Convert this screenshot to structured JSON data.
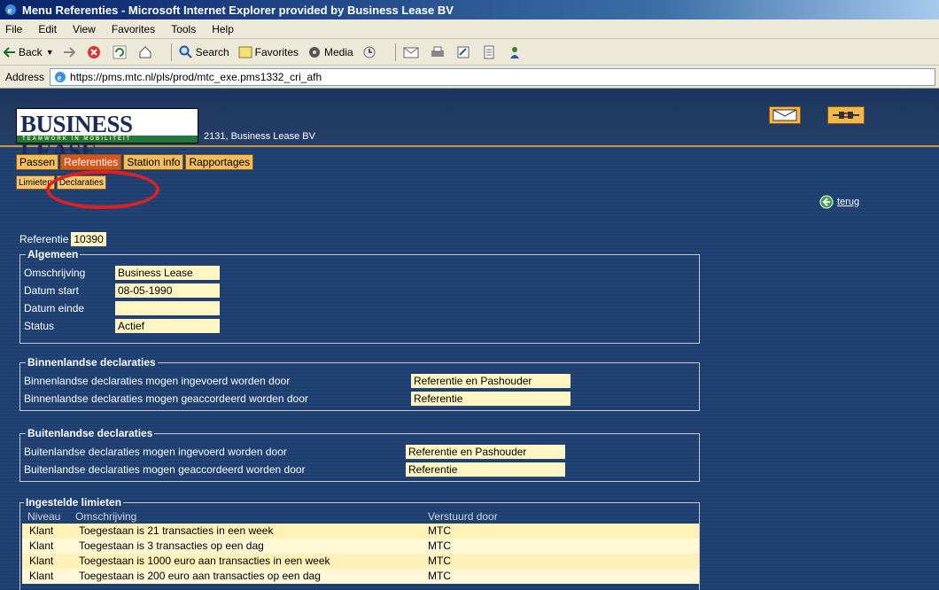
{
  "window": {
    "title": "Menu Referenties - Microsoft Internet Explorer provided by Business Lease BV"
  },
  "menu": [
    "File",
    "Edit",
    "View",
    "Favorites",
    "Tools",
    "Help"
  ],
  "toolbar": {
    "back": "Back",
    "search": "Search",
    "favorites": "Favorites",
    "media": "Media"
  },
  "address": {
    "label": "Address",
    "url": "https://pms.mtc.nl/pls/prod/mtc_exe.pms1332_cri_afh"
  },
  "header": {
    "logo_text": "BUSINESS LEASE",
    "logo_tagline": "TEAMWORK IN MOBILITEIT",
    "company": "2131, Business Lease BV"
  },
  "tabs": [
    "Passen",
    "Referenties",
    "Station info",
    "Rapportages"
  ],
  "subtabs": [
    "Limieten",
    "Declaraties"
  ],
  "back_link": "terug",
  "referentie": {
    "label": "Referentie",
    "value": "10390"
  },
  "algemeen": {
    "legend": "Algemeen",
    "rows": [
      {
        "label": "Omschrijving",
        "value": "Business Lease"
      },
      {
        "label": "Datum start",
        "value": "08-05-1990"
      },
      {
        "label": "Datum einde",
        "value": ""
      },
      {
        "label": "Status",
        "value": "Actief"
      }
    ]
  },
  "binnenland": {
    "legend": "Binnenlandse declaraties",
    "rows": [
      {
        "label": "Binnenlandse declaraties mogen ingevoerd worden door",
        "value": "Referentie en Pashouder"
      },
      {
        "label": "Binnenlandse declaraties mogen geaccordeerd worden door",
        "value": "Referentie"
      }
    ]
  },
  "buitenland": {
    "legend": "Buitenlandse declaraties",
    "rows": [
      {
        "label": "Buitenlandse declaraties mogen ingevoerd worden door",
        "value": "Referentie en Pashouder"
      },
      {
        "label": "Buitenlandse declaraties mogen geaccordeerd worden door",
        "value": "Referentie"
      }
    ]
  },
  "limieten": {
    "legend": "Ingestelde limieten",
    "headers": [
      "Niveau",
      "Omschrijving",
      "Verstuurd door"
    ],
    "rows": [
      [
        "Klant",
        "Toegestaan is 21 transacties in een week",
        "MTC"
      ],
      [
        "Klant",
        "Toegestaan is 3 transacties op een dag",
        "MTC"
      ],
      [
        "Klant",
        "Toegestaan is 1000 euro aan transacties in een week",
        "MTC"
      ],
      [
        "Klant",
        "Toegestaan is 200 euro aan transacties op een dag",
        "MTC"
      ]
    ]
  }
}
